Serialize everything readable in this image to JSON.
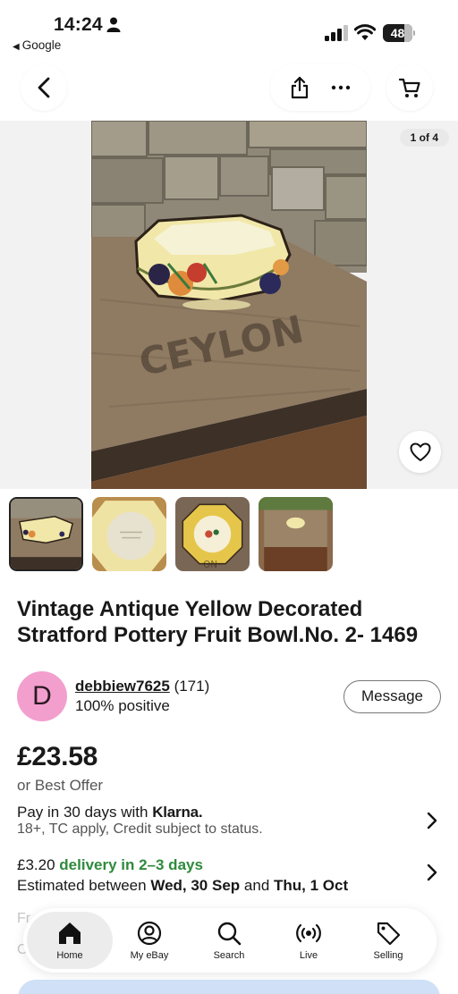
{
  "status_bar": {
    "time": "14:24",
    "back_app": "Google",
    "battery": "48"
  },
  "nav": {
    "back_icon": "chevron-left-icon",
    "share_icon": "share-icon",
    "more_icon": "more-icon",
    "cart_icon": "cart-icon"
  },
  "gallery": {
    "counter": "1 of 4",
    "thumbnail_count": 4,
    "selected_index": 0
  },
  "listing": {
    "title": "Vintage Antique Yellow Decorated Stratford Pottery Fruit Bowl.No. 2- 1469"
  },
  "seller": {
    "initial": "D",
    "name": "debbiew7625",
    "feedback_count": "(171)",
    "positive": "100% positive",
    "message_label": "Message"
  },
  "price": {
    "amount": "£23.58",
    "offer": "or Best Offer"
  },
  "klarna": {
    "prefix": "Pay in 30 days with",
    "brand": "Klarna.",
    "terms": "18+, TC apply, Credit subject to status."
  },
  "delivery": {
    "cost": "£3.20",
    "speed": "delivery in 2–3 days",
    "est_prefix": "Estimated between",
    "date_from": "Wed, 30 Sep",
    "and_word": "and",
    "date_to": "Thu, 1 Oct"
  },
  "faded": {
    "row1": "Fr",
    "row2": "C"
  },
  "tabs": [
    {
      "label": "Home",
      "icon": "home-icon"
    },
    {
      "label": "My eBay",
      "icon": "profile-icon"
    },
    {
      "label": "Search",
      "icon": "search-icon"
    },
    {
      "label": "Live",
      "icon": "live-icon"
    },
    {
      "label": "Selling",
      "icon": "tag-icon"
    }
  ],
  "colors": {
    "avatar": "#f39fce",
    "delivery_green": "#2f8a3c",
    "bowl_yellow": "#f1e7a9"
  }
}
